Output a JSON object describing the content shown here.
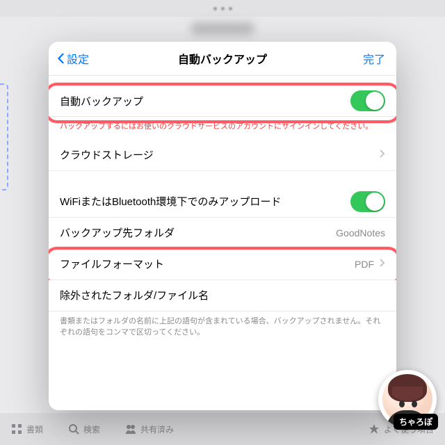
{
  "header": {
    "back_label": "設定",
    "title": "自動バックアップ",
    "done_label": "完了"
  },
  "rows": {
    "auto_backup": "自動バックアップ",
    "auto_backup_on": true,
    "signin_warning": "バックアップするにはお使いのクラウドサービスのアカウントにサインインしてください。",
    "cloud_storage": "クラウドストレージ",
    "wifi_bt_only": "WiFiまたはBluetooth環境下でのみアップロード",
    "wifi_bt_only_on": true,
    "dest_folder": "バックアップ先フォルダ",
    "dest_folder_value": "GoodNotes",
    "file_format": "ファイルフォーマット",
    "file_format_value": "PDF",
    "excluded": "除外されたフォルダ/ファイル名",
    "excluded_note": "書類またはフォルダの名前に上記の語句が含まれている場合、バックアップされません。それぞれの語句をコンマで区切ってください。"
  },
  "tabs": {
    "documents": "書類",
    "search": "検索",
    "shared": "共有済み",
    "favorites": "よく使う項目"
  },
  "avatar_name": "ちゃろぽ"
}
